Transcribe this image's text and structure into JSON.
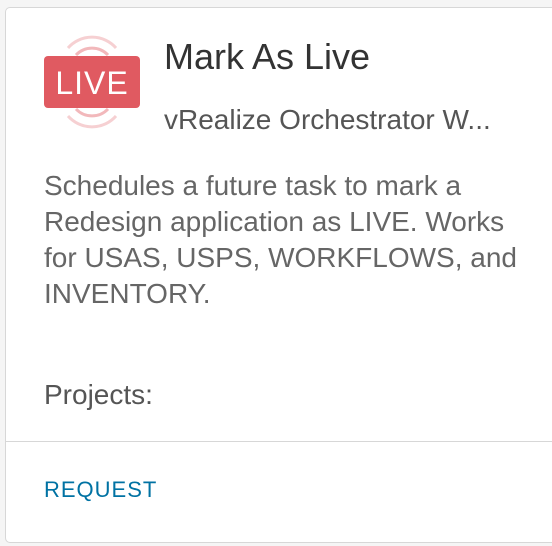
{
  "card": {
    "icon": {
      "name": "live-icon",
      "text": "LIVE",
      "color": "#e05a61"
    },
    "title": "Mark As Live",
    "subtitle": "vRealize Orchestrator W...",
    "description": " Schedules a future task to mark a Redesign application as LIVE. Works for USAS, USPS, WORKFLOWS, and INVENTORY.",
    "projects_label": "Projects:",
    "request_label": "REQUEST"
  }
}
